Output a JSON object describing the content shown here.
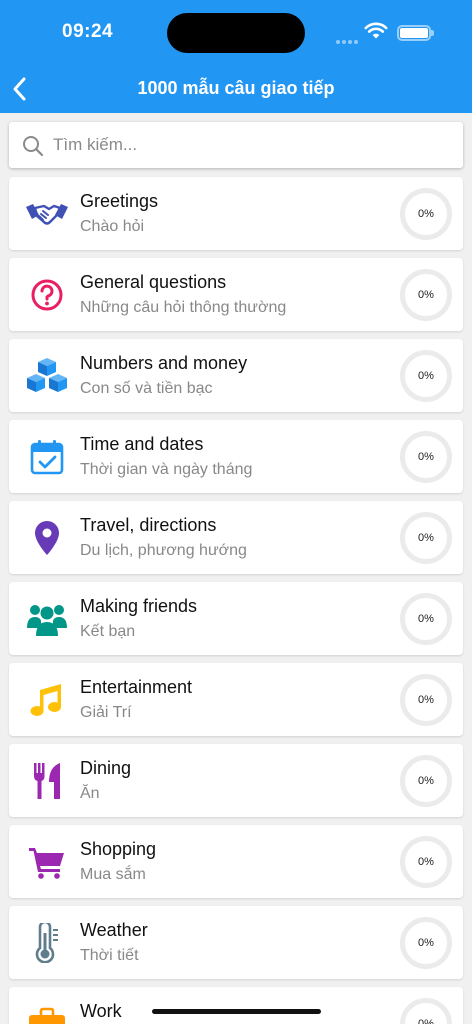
{
  "status_bar": {
    "time": "09:24"
  },
  "nav": {
    "title": "1000 mẫu câu giao tiếp"
  },
  "search": {
    "placeholder": "Tìm kiếm..."
  },
  "topics": [
    {
      "title": "Greetings",
      "subtitle": "Chào hỏi",
      "progress": "0%",
      "icon": "handshake-icon",
      "color": "#3f51b5"
    },
    {
      "title": "General questions",
      "subtitle": "Những câu hỏi thông thường",
      "progress": "0%",
      "icon": "question-circle-icon",
      "color": "#e91e63"
    },
    {
      "title": "Numbers and money",
      "subtitle": "Con số và tiền bạc",
      "progress": "0%",
      "icon": "cubes-icon",
      "color": "#2196f3"
    },
    {
      "title": "Time and dates",
      "subtitle": "Thời gian và ngày tháng",
      "progress": "0%",
      "icon": "calendar-check-icon",
      "color": "#2196f3"
    },
    {
      "title": "Travel, directions",
      "subtitle": "Du lịch, phương hướng",
      "progress": "0%",
      "icon": "map-pin-icon",
      "color": "#673ab7"
    },
    {
      "title": "Making friends",
      "subtitle": "Kết bạn",
      "progress": "0%",
      "icon": "users-icon",
      "color": "#009688"
    },
    {
      "title": "Entertainment",
      "subtitle": "Giải Trí",
      "progress": "0%",
      "icon": "music-icon",
      "color": "#ffc107"
    },
    {
      "title": "Dining",
      "subtitle": "Ăn",
      "progress": "0%",
      "icon": "utensils-icon",
      "color": "#9c27b0"
    },
    {
      "title": "Shopping",
      "subtitle": "Mua sắm",
      "progress": "0%",
      "icon": "shopping-cart-icon",
      "color": "#9c27b0"
    },
    {
      "title": "Weather",
      "subtitle": "Thời tiết",
      "progress": "0%",
      "icon": "thermometer-icon",
      "color": "#607d8b"
    },
    {
      "title": "Work",
      "subtitle": "",
      "progress": "0%",
      "icon": "briefcase-icon",
      "color": "#ff9800"
    }
  ]
}
